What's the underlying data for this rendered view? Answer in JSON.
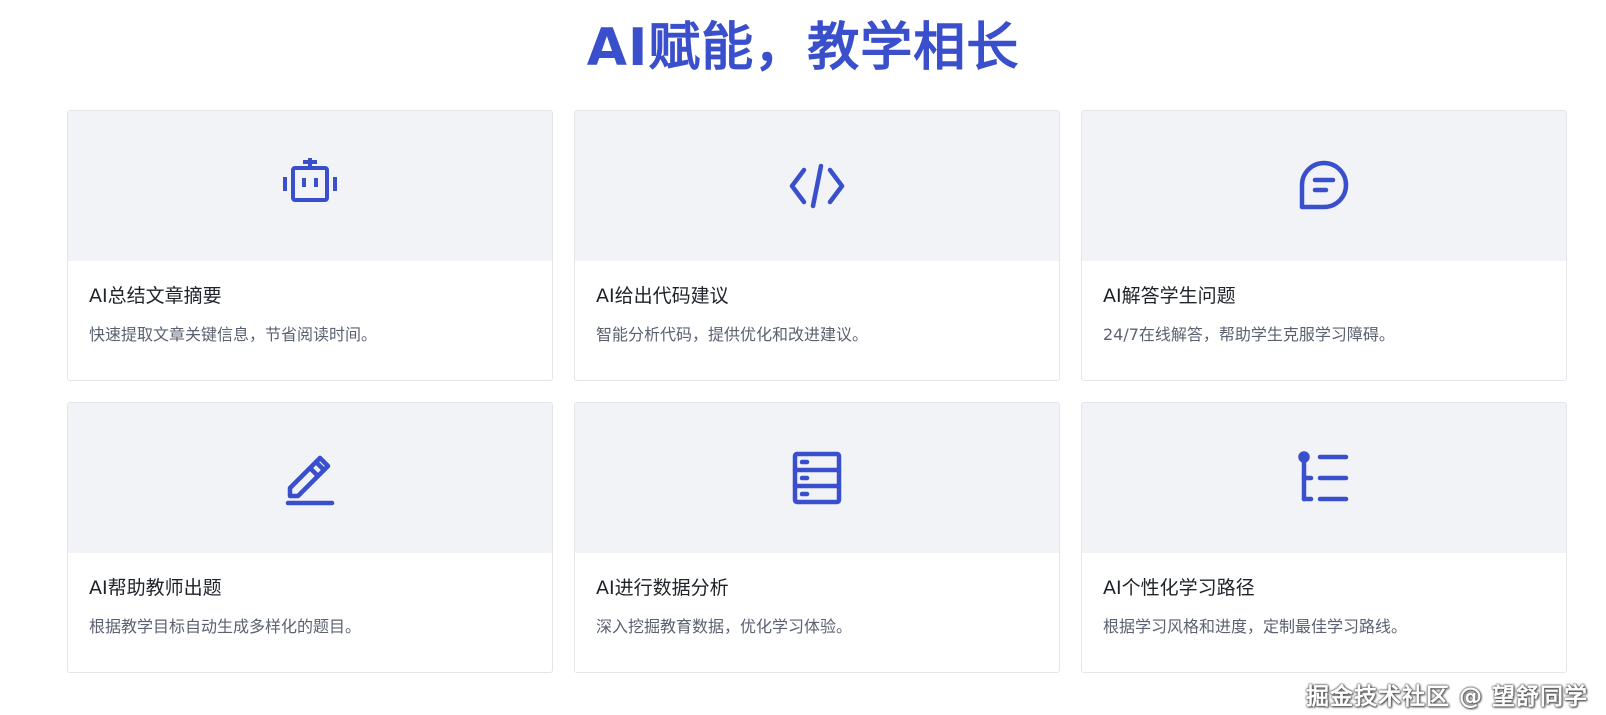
{
  "heading": "AI赋能，教学相长",
  "accent_color": "#3a4fcb",
  "cards": [
    {
      "icon": "robot-icon",
      "title": "AI总结文章摘要",
      "desc": "快速提取文章关键信息，节省阅读时间。"
    },
    {
      "icon": "code-icon",
      "title": "AI给出代码建议",
      "desc": "智能分析代码，提供优化和改进建议。"
    },
    {
      "icon": "message-icon",
      "title": "AI解答学生问题",
      "desc": "24/7在线解答，帮助学生克服学习障碍。"
    },
    {
      "icon": "edit-pen-icon",
      "title": "AI帮助教师出题",
      "desc": "根据教学目标自动生成多样化的题目。"
    },
    {
      "icon": "storage-icon",
      "title": "AI进行数据分析",
      "desc": "深入挖掘教育数据，优化学习体验。"
    },
    {
      "icon": "ordered-list-icon",
      "title": "AI个性化学习路径",
      "desc": "根据学习风格和进度，定制最佳学习路线。"
    }
  ],
  "watermark": "掘金技术社区 @ 望舒同学"
}
